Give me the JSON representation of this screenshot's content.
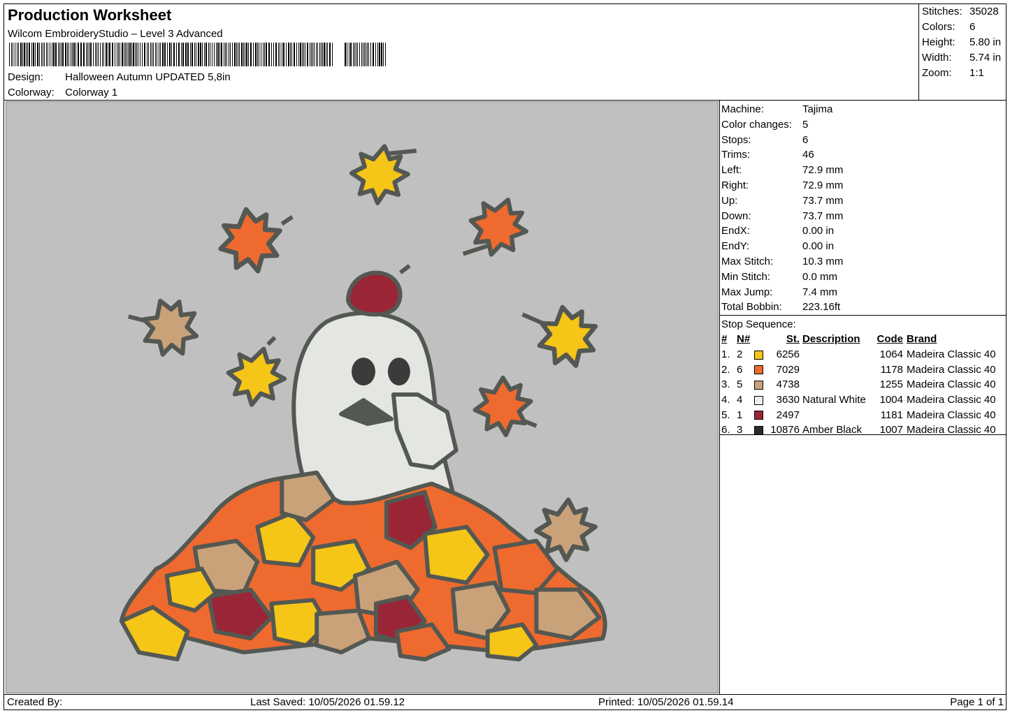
{
  "header": {
    "title": "Production Worksheet",
    "software": "Wilcom EmbroideryStudio – Level 3 Advanced",
    "design_label": "Design:",
    "design_value": "Halloween Autumn UPDATED 5,8in",
    "colorway_label": "Colorway:",
    "colorway_value": "Colorway 1"
  },
  "summary": [
    {
      "label": "Stitches:",
      "value": "35028"
    },
    {
      "label": "Colors:",
      "value": "6"
    },
    {
      "label": "Height:",
      "value": "5.80 in"
    },
    {
      "label": "Width:",
      "value": "5.74 in"
    },
    {
      "label": "Zoom:",
      "value": "1:1"
    }
  ],
  "machine_info": [
    {
      "label": "Machine:",
      "value": "Tajima"
    },
    {
      "label": "Color changes:",
      "value": "5"
    },
    {
      "label": "Stops:",
      "value": "6"
    },
    {
      "label": "Trims:",
      "value": "46"
    },
    {
      "label": "Left:",
      "value": "72.9 mm"
    },
    {
      "label": "Right:",
      "value": "72.9 mm"
    },
    {
      "label": "Up:",
      "value": "73.7 mm"
    },
    {
      "label": "Down:",
      "value": "73.7 mm"
    },
    {
      "label": "EndX:",
      "value": "0.00 in"
    },
    {
      "label": "EndY:",
      "value": "0.00 in"
    },
    {
      "label": "Max Stitch:",
      "value": "10.3 mm"
    },
    {
      "label": "Min Stitch:",
      "value": "0.0 mm"
    },
    {
      "label": "Max Jump:",
      "value": "7.4 mm"
    },
    {
      "label": "Total Bobbin:",
      "value": "223.16ft"
    }
  ],
  "stop_sequence": {
    "caption": "Stop Sequence:",
    "headers": {
      "hash": "#",
      "n": "N#",
      "st": "St.",
      "description": "Description",
      "code": "Code",
      "brand": "Brand"
    },
    "rows": [
      {
        "idx": "1.",
        "n": "2",
        "color": "#f5c518",
        "st": "6256",
        "description": "",
        "code": "1064",
        "brand": "Madeira Classic 40"
      },
      {
        "idx": "2.",
        "n": "6",
        "color": "#ef6a2e",
        "st": "7029",
        "description": "",
        "code": "1178",
        "brand": "Madeira Classic 40"
      },
      {
        "idx": "3.",
        "n": "5",
        "color": "#c9a27a",
        "st": "4738",
        "description": "",
        "code": "1255",
        "brand": "Madeira Classic 40"
      },
      {
        "idx": "4.",
        "n": "4",
        "color": "#efefef",
        "st": "3630",
        "description": "Natural White",
        "code": "1004",
        "brand": "Madeira Classic 40"
      },
      {
        "idx": "5.",
        "n": "1",
        "color": "#9a2536",
        "st": "2497",
        "description": "",
        "code": "1181",
        "brand": "Madeira Classic 40"
      },
      {
        "idx": "6.",
        "n": "3",
        "color": "#2b2b2b",
        "st": "10876",
        "description": "Amber Black",
        "code": "1007",
        "brand": "Madeira Classic 40"
      }
    ]
  },
  "footer": {
    "created_by": "Created By:",
    "last_saved": "Last Saved: 10/05/2026 01.59.12",
    "printed": "Printed: 10/05/2026 01.59.14",
    "page": "Page 1 of 1"
  },
  "colors": {
    "canvas_bg": "#c0c0c0",
    "outline": "#545852",
    "yellow": "#f5c518",
    "orange": "#ef6a2e",
    "tan": "#c9a27a",
    "white": "#e4e6e2",
    "maroon": "#9a2536"
  }
}
